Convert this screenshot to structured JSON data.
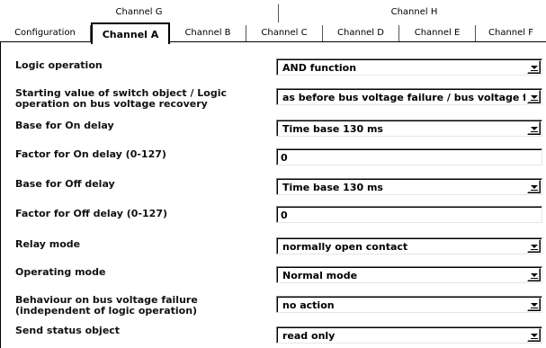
{
  "tabs_back": [
    "Channel G",
    "Channel H"
  ],
  "tabs_front": [
    "Configuration",
    "Channel A",
    "Channel B",
    "Channel C",
    "Channel D",
    "Channel E",
    "Channel F"
  ],
  "active_tab": "Channel A",
  "params": [
    {
      "label": "Logic operation",
      "type": "select",
      "value": "AND function"
    },
    {
      "label_line1": "Starting value of switch object / Logic",
      "label_line2": "operation on bus voltage recovery",
      "type": "select",
      "value": "as before bus voltage failure / bus voltage fail."
    },
    {
      "label": "Base for On delay",
      "type": "select",
      "value": "Time base 130 ms"
    },
    {
      "label": "Factor for On delay (0-127)",
      "type": "text",
      "value": "0"
    },
    {
      "label": "Base for Off delay",
      "type": "select",
      "value": "Time base 130 ms"
    },
    {
      "label": "Factor for Off delay (0-127)",
      "type": "text",
      "value": "0"
    },
    {
      "label": "Relay mode",
      "type": "select",
      "value": "normally open contact"
    },
    {
      "label": "Operating mode",
      "type": "select",
      "value": "Normal mode"
    },
    {
      "label_line1": "Behaviour on bus voltage failure",
      "label_line2": "(independent of logic operation)",
      "type": "select",
      "value": "no action"
    },
    {
      "label": "Send status object",
      "type": "select",
      "value": "read only"
    }
  ]
}
